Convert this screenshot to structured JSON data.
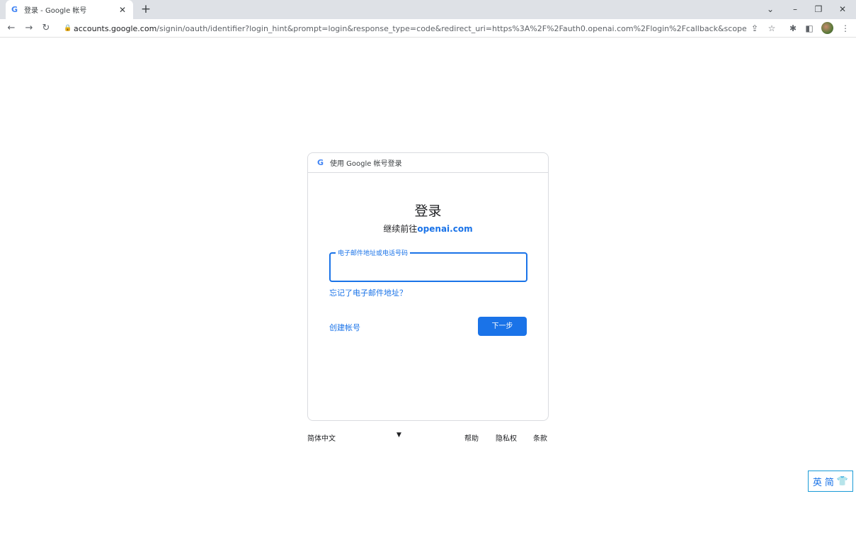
{
  "browser": {
    "tab_title": "登录 - Google 帐号",
    "tab_favicon": "G",
    "url_host": "accounts.google.com",
    "url_path": "/signin/oauth/identifier?login_hint&prompt=login&response_type=code&redirect_uri=https%3A%2F%2Fauth0.openai.com%2Flogin%2Fcallback&scope=email%2..."
  },
  "card": {
    "header_text": "使用 Google 帐号登录",
    "title": "登录",
    "subtitle_prefix": "继续前往",
    "subtitle_link": "openai.com",
    "email_label": "电子邮件地址或电话号码",
    "email_value": "",
    "forgot_email": "忘记了电子邮件地址？",
    "create_account": "创建帐号",
    "next_button": "下一步"
  },
  "footer": {
    "language": "简体中文",
    "help": "帮助",
    "privacy": "隐私权",
    "terms": "条款"
  },
  "ime": {
    "mode_en": "英",
    "mode_simplified": "简"
  },
  "colors": {
    "accent": "#1a73e8",
    "border": "#dadce0",
    "tabstrip": "#dee1e6"
  }
}
